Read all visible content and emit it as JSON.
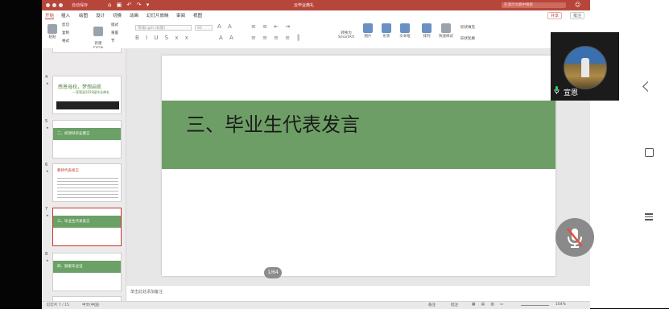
{
  "window": {
    "autosave_label": "自动保存",
    "title": "云毕业典礼",
    "search_placeholder": "在演示文稿中搜索"
  },
  "menu": {
    "tabs": [
      "开始",
      "插入",
      "绘图",
      "设计",
      "切换",
      "动画",
      "幻灯片放映",
      "审阅",
      "视图"
    ],
    "share": "共享",
    "comments": "批注"
  },
  "ribbon": {
    "paste": "粘贴",
    "cut": "剪切",
    "copy": "复制",
    "format": "格式",
    "new_slide": "新建\n幻灯片",
    "layout": "版式",
    "reset": "重置",
    "section": "节",
    "font_placeholder": "等线Light (标题)",
    "font_size": "60",
    "convert_smartart": "转换为\nSmartArt",
    "picture": "图片",
    "shapes": "形状",
    "textbox": "文本框",
    "arrange": "排列",
    "quick_styles": "快速样式",
    "shape_fill": "形状填充",
    "shape_outline": "形状轮廓"
  },
  "thumbnails": [
    {
      "num": "4",
      "star": "★",
      "title": "感恩母校，梦想启航",
      "subtitle": "—宣恩县2020届毕业典礼"
    },
    {
      "num": "5",
      "star": "★",
      "label": "二、校领导毕业赠言"
    },
    {
      "num": "6",
      "star": "★",
      "title": "教师代表发言"
    },
    {
      "num": "7",
      "star": "★",
      "label": "三、毕业生代表发言"
    },
    {
      "num": "8",
      "star": "★",
      "label": "四、颁发毕业证"
    }
  ],
  "slide": {
    "title": "三、毕业生代表发言"
  },
  "page_indicator": "1/64",
  "notes_placeholder": "单击此处添加备注",
  "statusbar": {
    "slide_count": "幻灯片 7 / 15",
    "language": "中文(中国)",
    "notes": "备注",
    "comments": "批注",
    "zoom": "104%"
  },
  "video": {
    "participant_name": "宣恩"
  }
}
